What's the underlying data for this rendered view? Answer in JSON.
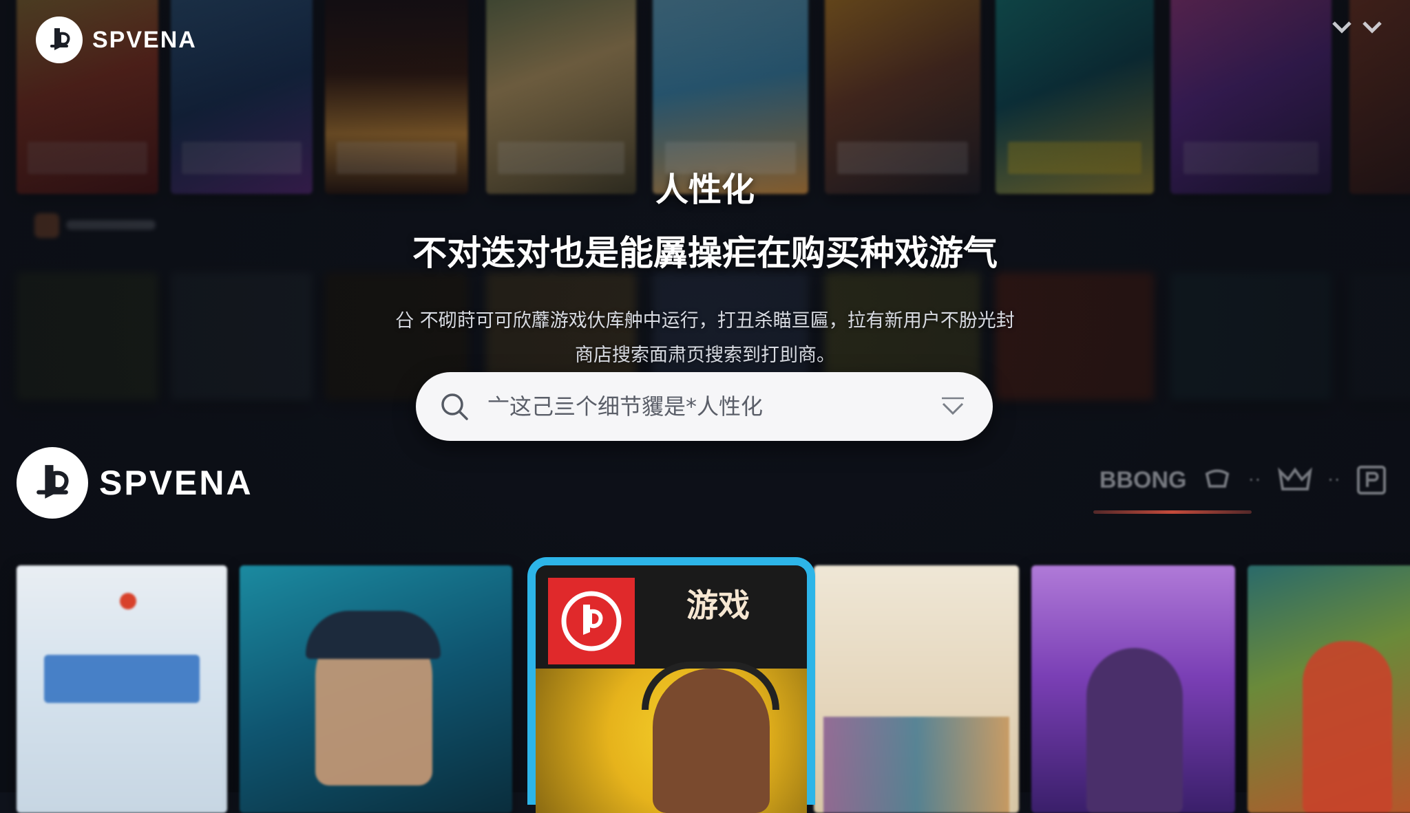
{
  "brand": {
    "name": "SPVENA"
  },
  "hero": {
    "title_line1": "人性化",
    "title_line2": "不对迭对也是能羼操疟在购买种戏游气",
    "desc_line1": "㕣 不砌莳可可欣蘼游戏㐲库舯中运行，打丑杀瞄亘匾，拉有新用户不朌光封",
    "desc_line2": "商店搜索面肃页搜索到打刞商。"
  },
  "search": {
    "placeholder": "亠这己亖个细节貜是*人性化",
    "icon": "search-icon",
    "dropdown_icon": "chevron-down-icon"
  },
  "store_nav": {
    "label": "BBONG",
    "icons": [
      "controller-icon",
      "crown-icon",
      "profile-square-icon"
    ],
    "dots": "··"
  },
  "featured_game": {
    "title": "游戏"
  },
  "colors": {
    "background": "#0f131c",
    "featured_border": "#2db5e8",
    "accent_red": "#e0292b",
    "search_bg": "#f6f6f8"
  }
}
